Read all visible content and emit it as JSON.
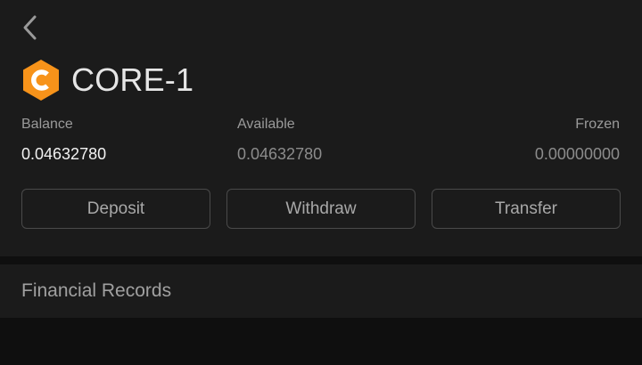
{
  "header": {
    "back_icon": "chevron-left-icon",
    "coin_icon": "core-coin-logo",
    "coin_name": "CORE-1"
  },
  "stats": {
    "balance": {
      "label": "Balance",
      "value": "0.04632780"
    },
    "available": {
      "label": "Available",
      "value": "0.04632780"
    },
    "frozen": {
      "label": "Frozen",
      "value": "0.00000000"
    }
  },
  "actions": {
    "deposit": "Deposit",
    "withdraw": "Withdraw",
    "transfer": "Transfer"
  },
  "records": {
    "title": "Financial Records"
  },
  "colors": {
    "accent_orange": "#f7931a",
    "background": "#1b1b1b",
    "page_background": "#0f0f0f"
  }
}
